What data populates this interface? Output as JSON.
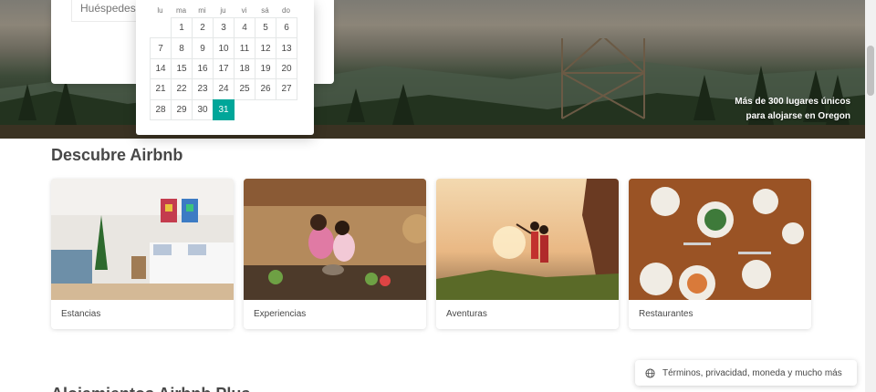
{
  "hero": {
    "caption_line1": "Más de 300 lugares únicos",
    "caption_line2": "para alojarse en Oregon"
  },
  "search": {
    "guests_label": "Huéspedes"
  },
  "calendar": {
    "weekdays": [
      "lu",
      "ma",
      "mi",
      "ju",
      "vi",
      "sá",
      "do"
    ],
    "leading_blanks": 1,
    "days": [
      "1",
      "2",
      "3",
      "4",
      "5",
      "6",
      "7",
      "8",
      "9",
      "10",
      "11",
      "12",
      "13",
      "14",
      "15",
      "16",
      "17",
      "18",
      "19",
      "20",
      "21",
      "22",
      "23",
      "24",
      "25",
      "26",
      "27",
      "28",
      "29",
      "30",
      "31"
    ],
    "selected_day": "31"
  },
  "discover": {
    "title": "Descubre Airbnb",
    "cards": [
      {
        "label": "Estancias"
      },
      {
        "label": "Experiencias"
      },
      {
        "label": "Aventuras"
      },
      {
        "label": "Restaurantes"
      }
    ]
  },
  "next_section": {
    "title": "Alojamientos Airbnb Plus"
  },
  "footer": {
    "icon": "globe-icon",
    "label": "Términos, privacidad, moneda y mucho más"
  },
  "colors": {
    "selected_day": "#00a699",
    "text": "#484848"
  }
}
